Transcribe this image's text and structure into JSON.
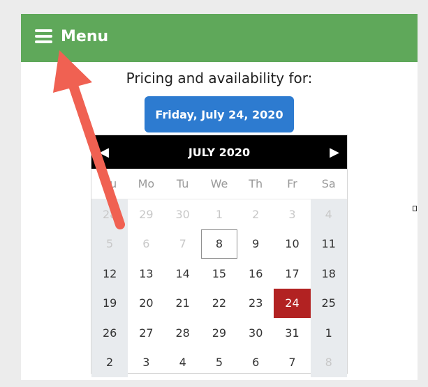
{
  "header": {
    "menu_label": "Menu",
    "menu_icon": "hamburger-icon",
    "color": "#5fa85a"
  },
  "pricing": {
    "title": "Pricing and availability for:",
    "selected_date_label": "Friday, July 24, 2020",
    "button_color": "#2d7bd0"
  },
  "calendar": {
    "month_title": "JULY 2020",
    "prev_icon": "chevron-left-icon",
    "next_icon": "chevron-right-icon",
    "prev_glyph": "◀",
    "next_glyph": "▶",
    "weekdays": [
      "Su",
      "Mo",
      "Tu",
      "We",
      "Th",
      "Fr",
      "Sa"
    ],
    "weeks": [
      [
        "28",
        "29",
        "30",
        "1",
        "2",
        "3",
        "4"
      ],
      [
        "5",
        "6",
        "7",
        "8",
        "9",
        "10",
        "11"
      ],
      [
        "12",
        "13",
        "14",
        "15",
        "16",
        "17",
        "18"
      ],
      [
        "19",
        "20",
        "21",
        "22",
        "23",
        "24",
        "25"
      ],
      [
        "26",
        "27",
        "28",
        "29",
        "30",
        "31",
        "1"
      ],
      [
        "2",
        "3",
        "4",
        "5",
        "6",
        "7",
        "8"
      ]
    ],
    "disabled_cells": [
      "0-0",
      "0-1",
      "0-2",
      "0-3",
      "0-4",
      "0-5",
      "0-6",
      "1-0",
      "1-1",
      "1-2",
      "5-6"
    ],
    "today_cell": "1-3",
    "selected_cell": "3-5",
    "selected_color": "#b22222"
  },
  "annotation": {
    "arrow_color": "#f06152"
  }
}
